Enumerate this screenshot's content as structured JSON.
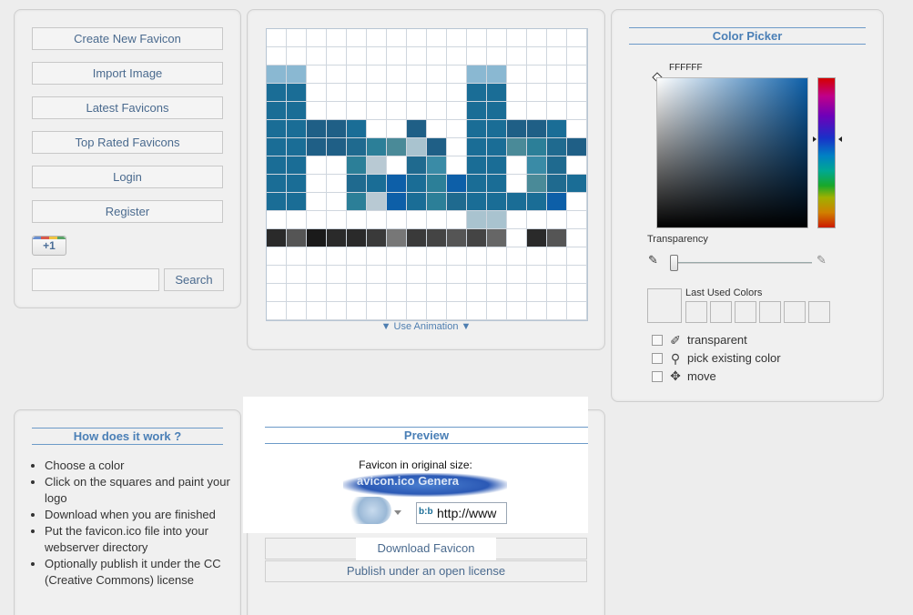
{
  "nav": {
    "create_new": "Create New Favicon",
    "import_image": "Import Image",
    "latest": "Latest Favicons",
    "top_rated": "Top Rated Favicons",
    "login": "Login",
    "register": "Register",
    "plus_one": "+1",
    "search_placeholder": "",
    "search_button": "Search"
  },
  "editor": {
    "use_animation": "▼ Use Animation ▼",
    "grid_rows": [
      [
        "",
        "",
        "",
        "",
        "",
        "",
        "",
        "",
        "",
        "",
        "",
        "",
        "",
        "",
        "",
        ""
      ],
      [
        "",
        "",
        "",
        "",
        "",
        "",
        "",
        "",
        "",
        "",
        "",
        "",
        "",
        "",
        "",
        ""
      ],
      [
        "#8ab8d2",
        "#8ab8d2",
        "",
        "",
        "",
        "",
        "",
        "",
        "",
        "",
        "#8ab8d2",
        "#8ab8d2",
        "",
        "",
        "",
        ""
      ],
      [
        "#1a6d96",
        "#1a6d96",
        "",
        "",
        "",
        "",
        "",
        "",
        "",
        "",
        "#1a6d96",
        "#1a6d96",
        "",
        "",
        "",
        ""
      ],
      [
        "#1a6d96",
        "#1a6d96",
        "",
        "",
        "",
        "",
        "",
        "",
        "",
        "",
        "#1a6d96",
        "#1a6d96",
        "",
        "",
        "",
        ""
      ],
      [
        "#1a6d96",
        "#1a6d96",
        "#1f5f86",
        "#1f5f86",
        "#1a6d96",
        "",
        "",
        "#1f5f86",
        "",
        "",
        "#1a6d96",
        "#1a6d96",
        "#1f5f86",
        "#1f5f86",
        "#1a6d96",
        ""
      ],
      [
        "#1a6d96",
        "#1a6d96",
        "#1f5f86",
        "#1f5f86",
        "#1f6a8f",
        "#2c7f98",
        "#4a8a98",
        "#a9c3cf",
        "#1f5f86",
        "",
        "#1a6d96",
        "#1a6d96",
        "#4a8a98",
        "#2c7f98",
        "#1f6a8f",
        "#1f5f86"
      ],
      [
        "#1a6d96",
        "#1a6d96",
        "",
        "",
        "#2c7f98",
        "#b8c9d3",
        "",
        "#1f6a8f",
        "#3a8ba6",
        "",
        "#1a6d96",
        "#1a6d96",
        "",
        "#3a8ba6",
        "#1f6a8f",
        ""
      ],
      [
        "#1a6d96",
        "#1a6d96",
        "",
        "",
        "#1f6a8f",
        "#1a6d96",
        "#0d5fa8",
        "#1a6d96",
        "#2c7f98",
        "#0d5fa8",
        "#1a6d96",
        "#1a6d96",
        "",
        "#4a8a98",
        "#1f6a8f",
        "#1a6d96"
      ],
      [
        "#1a6d96",
        "#1a6d96",
        "",
        "",
        "#2c7f98",
        "#b8c9d3",
        "#0d5fa8",
        "#1a6d96",
        "#2c7f98",
        "#1f6a8f",
        "#1a6d96",
        "#1a6d96",
        "#1a6d96",
        "#1a6d96",
        "#0d5fa8",
        ""
      ],
      [
        "",
        "",
        "",
        "",
        "",
        "",
        "",
        "",
        "",
        "",
        "#a9c3cf",
        "#a9c3cf",
        "",
        "",
        "",
        ""
      ],
      [
        "#2a2a2a",
        "#555",
        "#1a1a1a",
        "#2a2a2a",
        "#2a2a2a",
        "#3a3a3a",
        "#777",
        "#3a3a3a",
        "#444",
        "#555",
        "#444",
        "#666",
        "",
        "#2a2a2a",
        "#555",
        ""
      ],
      [
        "",
        "",
        "",
        "",
        "",
        "",
        "",
        "",
        "",
        "",
        "",
        "",
        "",
        "",
        "",
        ""
      ],
      [
        "",
        "",
        "",
        "",
        "",
        "",
        "",
        "",
        "",
        "",
        "",
        "",
        "",
        "",
        "",
        ""
      ],
      [
        "",
        "",
        "",
        "",
        "",
        "",
        "",
        "",
        "",
        "",
        "",
        "",
        "",
        "",
        "",
        ""
      ],
      [
        "",
        "",
        "",
        "",
        "",
        "",
        "",
        "",
        "",
        "",
        "",
        "",
        "",
        "",
        "",
        ""
      ]
    ]
  },
  "picker": {
    "title": "Color Picker",
    "hex_value": "FFFFFF",
    "transparency_label": "Transparency",
    "last_used_label": "Last Used Colors",
    "options": [
      "transparent",
      "pick existing color",
      "move"
    ]
  },
  "how": {
    "title": "How does it work ?",
    "steps": [
      "Choose a color",
      "Click on the squares and paint your logo",
      "Download when you are finished",
      "Put the favicon.ico file into your webserver directory",
      "Optionally publish it under the CC (Creative Commons) license"
    ]
  },
  "preview": {
    "title": "Preview",
    "caption": "Favicon in original size:",
    "browser_title": "avicon.ico Genera",
    "address_text": "http://www",
    "download_button": "Download Favicon",
    "publish_button": "Publish under an open license"
  }
}
